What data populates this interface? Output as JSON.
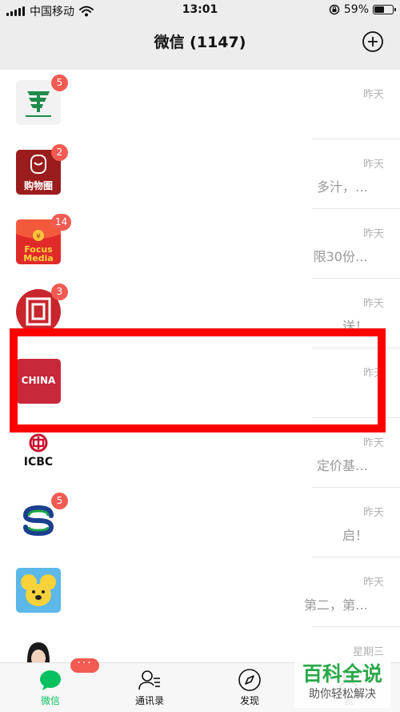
{
  "status_bar": {
    "carrier": "中国移动",
    "time": "13:01",
    "battery": "59%",
    "battery_level": 0.59
  },
  "header": {
    "title": "微信 (1147)",
    "add_icon": "plus-circle-icon"
  },
  "chats": [
    {
      "avatar": "china-post-logo",
      "badge": "5",
      "time": "昨天",
      "preview": ""
    },
    {
      "avatar": "gouwuquan-logo",
      "avatar_text": "购物圈",
      "badge": "2",
      "time": "昨天",
      "preview": "多汁，…"
    },
    {
      "avatar": "focus-media-logo",
      "avatar_text": "Focus Media",
      "badge": "14",
      "time": "昨天",
      "preview": "限30份…"
    },
    {
      "avatar": "red-circle-logo",
      "badge": "3",
      "time": "昨天",
      "preview": "送！"
    },
    {
      "avatar": "china-logo",
      "avatar_text": "CHINA",
      "badge": "",
      "time": "昨天",
      "preview": ""
    },
    {
      "avatar": "icbc-logo",
      "avatar_text": "ICBC",
      "badge": "",
      "time": "昨天",
      "preview": "定价基…"
    },
    {
      "avatar": "s-bank-logo",
      "badge": "5",
      "time": "昨天",
      "preview": "启！"
    },
    {
      "avatar": "cartoon-koala-avatar",
      "badge": "",
      "time": "昨天",
      "preview": "第二，第…"
    },
    {
      "avatar": "person-avatar",
      "badge": "",
      "time": "星期三",
      "preview": ""
    }
  ],
  "tabs": [
    {
      "label": "微信",
      "icon": "chat-bubble-icon",
      "active": true,
      "badge": "···"
    },
    {
      "label": "通讯录",
      "icon": "contacts-icon",
      "active": false
    },
    {
      "label": "发现",
      "icon": "compass-icon",
      "active": false
    },
    {
      "label": "我",
      "icon": "person-icon",
      "active": false
    }
  ],
  "colors": {
    "accent": "#07c160",
    "badge": "#f25b52",
    "highlight": "#ff0000"
  },
  "watermark": {
    "line1": "百科全说",
    "line2": "助你轻松解决"
  }
}
